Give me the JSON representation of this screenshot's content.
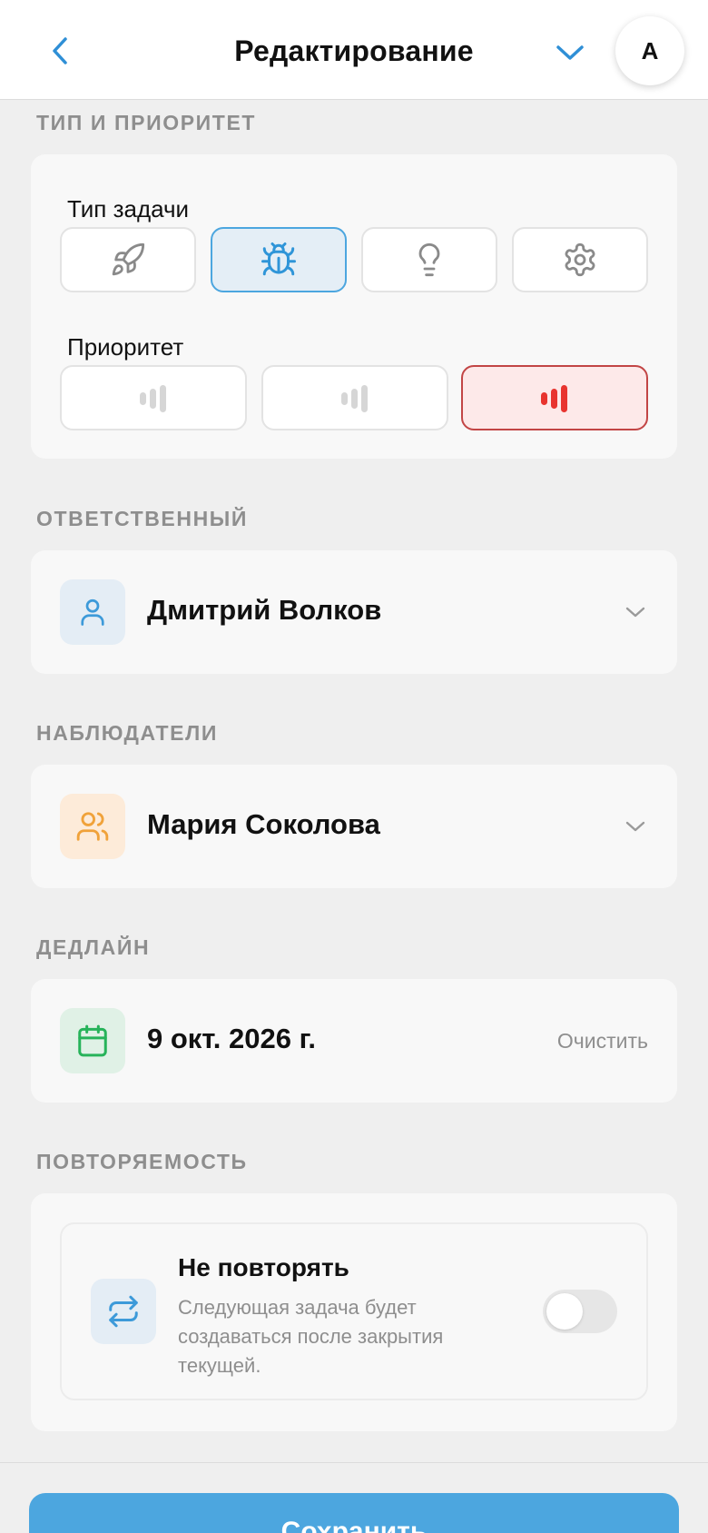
{
  "header": {
    "title": "Редактирование",
    "avatar_letter": "A"
  },
  "type_priority": {
    "section_label": "ТИП И ПРИОРИТЕТ",
    "task_type_label": "Тип задачи",
    "task_types": [
      {
        "icon": "rocket-icon",
        "selected": false
      },
      {
        "icon": "bug-icon",
        "selected": true
      },
      {
        "icon": "lightbulb-icon",
        "selected": false
      },
      {
        "icon": "gear-icon",
        "selected": false
      }
    ],
    "priority_label": "Приоритет",
    "priorities": [
      {
        "icon": "priority-low-icon",
        "selected": false
      },
      {
        "icon": "priority-medium-icon",
        "selected": false
      },
      {
        "icon": "priority-high-icon",
        "selected": true
      }
    ]
  },
  "assignee": {
    "section_label": "ОТВЕТСТВЕННЫЙ",
    "name": "Дмитрий Волков"
  },
  "watchers": {
    "section_label": "НАБЛЮДАТЕЛИ",
    "name": "Мария Соколова"
  },
  "deadline": {
    "section_label": "ДЕДЛАЙН",
    "date": "9 окт. 2026 г.",
    "clear_label": "Очистить"
  },
  "recurrence": {
    "section_label": "ПОВТОРЯЕМОСТЬ",
    "title": "Не повторять",
    "description": "Следующая задача будет создаваться после закрытия текущей.",
    "enabled": false
  },
  "footer": {
    "save_label": "Сохранить"
  },
  "colors": {
    "accent": "#4ca6df",
    "priority_high": "#e8342f",
    "deadline_icon": "#27b35a",
    "watchers_icon": "#f0a23a"
  }
}
